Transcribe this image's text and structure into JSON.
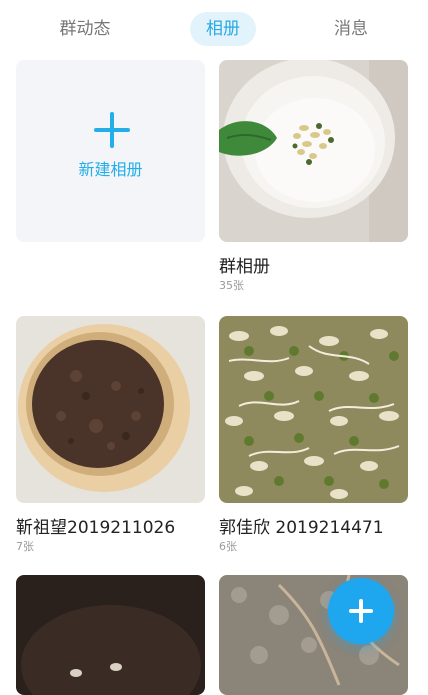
{
  "tabs": {
    "group_dynamics": "群动态",
    "album": "相册",
    "messages": "消息"
  },
  "new_album": {
    "label": "新建相册"
  },
  "albums": [
    {
      "title": "群相册",
      "count": "35张"
    },
    {
      "title": "靳祖望2019211026",
      "count": "7张"
    },
    {
      "title": "郭佳欣 2019214471",
      "count": "6张"
    }
  ],
  "colors": {
    "accent": "#23aee9",
    "active_tab_bg": "#e3f3fb"
  }
}
